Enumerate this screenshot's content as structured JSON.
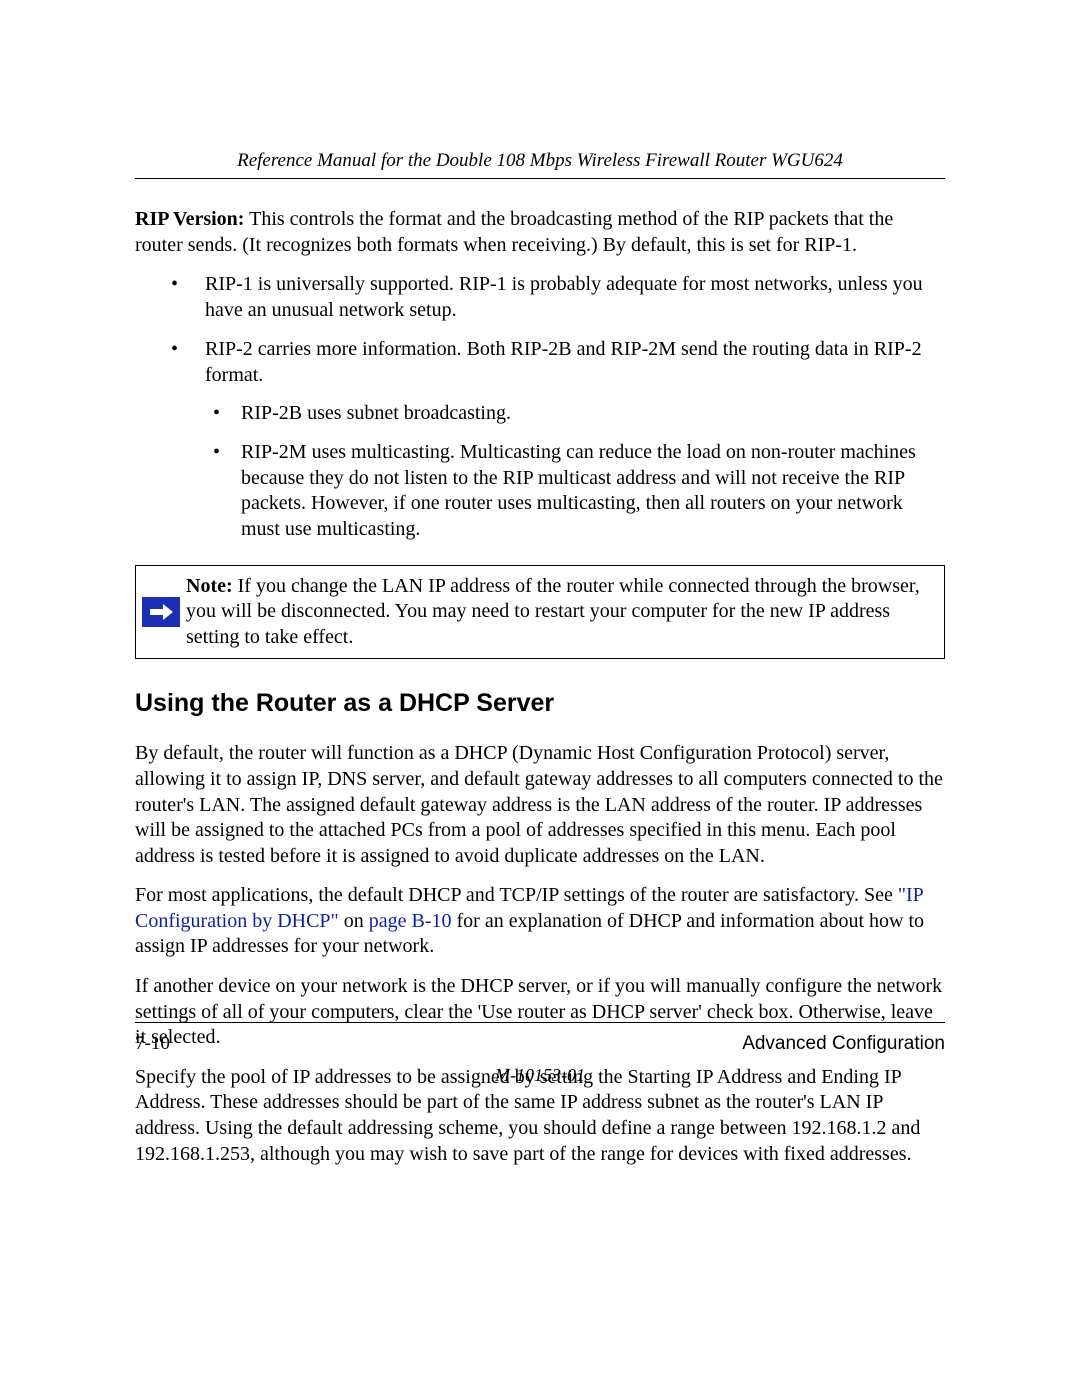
{
  "header": {
    "title": "Reference Manual for the Double 108 Mbps Wireless Firewall Router WGU624"
  },
  "rip_intro": {
    "label": "RIP Version:",
    "text": " This controls the format and the broadcasting method of the RIP packets that the router sends. (It recognizes both formats when receiving.) By default, this is set for RIP-1."
  },
  "rip_list": {
    "item1": "RIP-1 is universally supported. RIP-1 is probably adequate for most networks, unless you have an unusual network setup.",
    "item2": "RIP-2 carries more information. Both RIP-2B and RIP-2M send the routing data in RIP-2 format.",
    "sub1": "RIP-2B uses subnet broadcasting.",
    "sub2": "RIP-2M uses multicasting. Multicasting can reduce the load on non-router machines because they do not listen to the RIP multicast address and will not receive the RIP packets. However, if one router uses multicasting, then all routers on your network must use multicasting."
  },
  "note": {
    "label": "Note:",
    "text": " If you change the LAN IP address of the router while connected through the browser, you will be disconnected. You may need to restart your computer for the new IP address setting to take effect."
  },
  "section_heading": "Using the Router as a DHCP Server",
  "paras": {
    "p1": "By default, the router will function as a DHCP (Dynamic Host Configuration Protocol) server, allowing it to assign IP, DNS server, and default gateway addresses to all computers connected to the router's LAN. The assigned default gateway address is the LAN address of the router. IP addresses will be assigned to the attached PCs from a pool of addresses specified in this menu. Each pool address is tested before it is assigned to avoid duplicate addresses on the LAN.",
    "p2a": "For most applications, the default DHCP and TCP/IP settings of the router are satisfactory. See ",
    "p2_link1": "\"IP Configuration by DHCP\"",
    "p2_mid": " on ",
    "p2_link2": "page B-10",
    "p2b": " for an explanation of DHCP and information about how to assign IP addresses for your network.",
    "p3": "If another device on your network is the DHCP server, or if you will manually configure the network settings of all of your computers, clear the 'Use router as DHCP server' check box. Otherwise, leave it selected.",
    "p4": "Specify the pool of IP addresses to be assigned by setting the Starting IP Address and Ending IP Address. These addresses should be part of the same IP address subnet as the router's LAN IP address. Using the default addressing scheme, you should define a range between 192.168.1.2 and 192.168.1.253, although you may wish to save part of the range for devices with fixed addresses."
  },
  "footer": {
    "page_number": "7-10",
    "chapter": "Advanced Configuration",
    "doc_id": "M-10153-01"
  }
}
